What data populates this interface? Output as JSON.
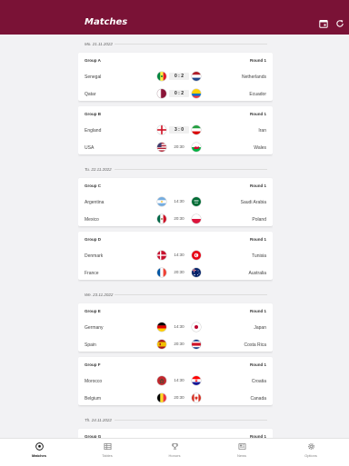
{
  "header": {
    "title": "Matches",
    "calendar_icon": "calendar-icon",
    "refresh_icon": "refresh-icon",
    "bg_color": "#7a1236"
  },
  "days": [
    {
      "date": "Mo. 21.11.2022",
      "groups": [
        {
          "group": "Group A",
          "round": "Round 1",
          "matches": [
            {
              "home": "Senegal",
              "home_flag": "senegal-flag",
              "mid": "0 : 2",
              "is_score": true,
              "away": "Netherlands",
              "away_flag": "netherlands-flag"
            },
            {
              "home": "Qatar",
              "home_flag": "qatar-flag",
              "mid": "0 : 2",
              "is_score": true,
              "away": "Ecuador",
              "away_flag": "ecuador-flag"
            }
          ]
        },
        {
          "group": "Group B",
          "round": "Round 1",
          "matches": [
            {
              "home": "England",
              "home_flag": "england-flag",
              "mid": "3 : 0",
              "is_score": true,
              "away": "Iran",
              "away_flag": "iran-flag"
            },
            {
              "home": "USA",
              "home_flag": "usa-flag",
              "mid": "20:30",
              "is_score": false,
              "away": "Wales",
              "away_flag": "wales-flag"
            }
          ]
        }
      ]
    },
    {
      "date": "Tu. 22.11.2022",
      "groups": [
        {
          "group": "Group C",
          "round": "Round 1",
          "matches": [
            {
              "home": "Argentina",
              "home_flag": "argentina-flag",
              "mid": "14:30",
              "is_score": false,
              "away": "Saudi Arabia",
              "away_flag": "saudi-arabia-flag"
            },
            {
              "home": "Mexico",
              "home_flag": "mexico-flag",
              "mid": "20:30",
              "is_score": false,
              "away": "Poland",
              "away_flag": "poland-flag"
            }
          ]
        },
        {
          "group": "Group D",
          "round": "Round 1",
          "matches": [
            {
              "home": "Denmark",
              "home_flag": "denmark-flag",
              "mid": "14:30",
              "is_score": false,
              "away": "Tunisia",
              "away_flag": "tunisia-flag"
            },
            {
              "home": "France",
              "home_flag": "france-flag",
              "mid": "20:30",
              "is_score": false,
              "away": "Australia",
              "away_flag": "australia-flag"
            }
          ]
        }
      ]
    },
    {
      "date": "We. 23.11.2022",
      "groups": [
        {
          "group": "Group E",
          "round": "Round 1",
          "matches": [
            {
              "home": "Germany",
              "home_flag": "germany-flag",
              "mid": "14:30",
              "is_score": false,
              "away": "Japan",
              "away_flag": "japan-flag"
            },
            {
              "home": "Spain",
              "home_flag": "spain-flag",
              "mid": "20:30",
              "is_score": false,
              "away": "Costa Rica",
              "away_flag": "costa-rica-flag"
            }
          ]
        },
        {
          "group": "Group F",
          "round": "Round 1",
          "matches": [
            {
              "home": "Morocco",
              "home_flag": "morocco-flag",
              "mid": "14:30",
              "is_score": false,
              "away": "Croatia",
              "away_flag": "croatia-flag"
            },
            {
              "home": "Belgium",
              "home_flag": "belgium-flag",
              "mid": "20:30",
              "is_score": false,
              "away": "Canada",
              "away_flag": "canada-flag"
            }
          ]
        }
      ]
    },
    {
      "date": "Th. 24.11.2022",
      "groups": [
        {
          "group": "Group G",
          "round": "Round 1",
          "matches": []
        }
      ]
    }
  ],
  "nav": [
    {
      "label": "Matches",
      "icon": "soccer-ball-icon",
      "active": true
    },
    {
      "label": "Tables",
      "icon": "table-icon",
      "active": false
    },
    {
      "label": "Honors",
      "icon": "trophy-icon",
      "active": false
    },
    {
      "label": "News",
      "icon": "news-icon",
      "active": false
    },
    {
      "label": "Options",
      "icon": "gear-icon",
      "active": false
    }
  ]
}
